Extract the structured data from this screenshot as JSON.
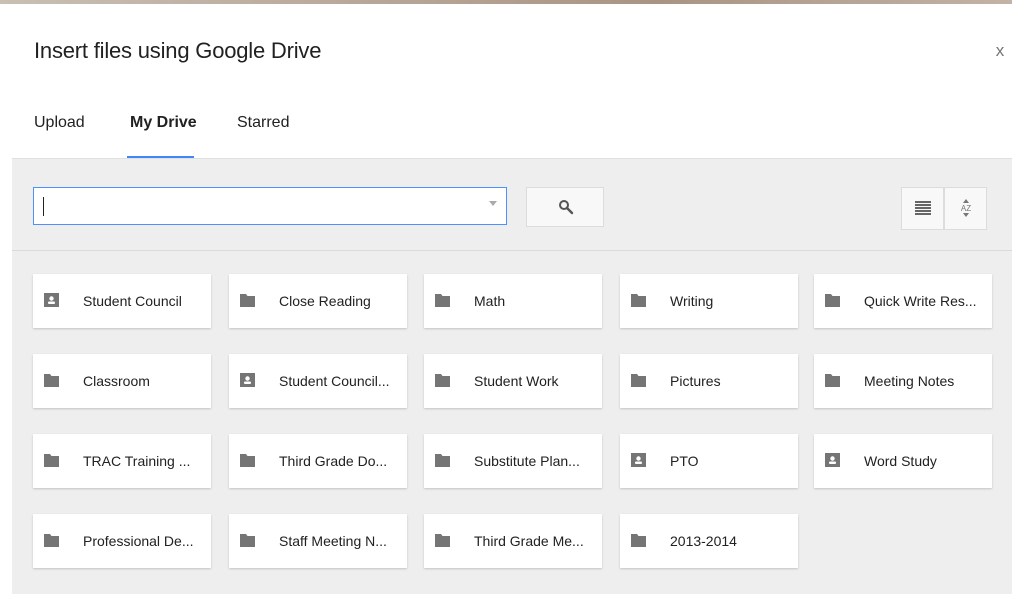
{
  "dialog": {
    "title": "Insert files using Google Drive",
    "close_label": "x"
  },
  "tabs": [
    {
      "label": "Upload",
      "active": false
    },
    {
      "label": "My Drive",
      "active": true
    },
    {
      "label": "Starred",
      "active": false
    }
  ],
  "search": {
    "value": "",
    "search_icon": "magnifier-icon"
  },
  "view_controls": {
    "list_view_icon": "list-view-icon",
    "sort_icon": "sort-az-icon",
    "sort_label": "AZ"
  },
  "folders": [
    {
      "label": "Student Council",
      "icon": "shared-folder-icon"
    },
    {
      "label": "Close Reading",
      "icon": "folder-icon"
    },
    {
      "label": "Math",
      "icon": "folder-icon"
    },
    {
      "label": "Writing",
      "icon": "folder-icon"
    },
    {
      "label": "Quick Write Res...",
      "icon": "folder-icon"
    },
    {
      "label": "Classroom",
      "icon": "folder-icon"
    },
    {
      "label": "Student Council...",
      "icon": "shared-folder-icon"
    },
    {
      "label": "Student Work",
      "icon": "folder-icon"
    },
    {
      "label": "Pictures",
      "icon": "folder-icon"
    },
    {
      "label": "Meeting Notes",
      "icon": "folder-icon"
    },
    {
      "label": "TRAC Training ...",
      "icon": "folder-icon"
    },
    {
      "label": "Third Grade Do...",
      "icon": "folder-icon"
    },
    {
      "label": "Substitute Plan...",
      "icon": "folder-icon"
    },
    {
      "label": "PTO",
      "icon": "shared-folder-icon"
    },
    {
      "label": "Word Study",
      "icon": "shared-folder-icon"
    },
    {
      "label": "Professional De...",
      "icon": "folder-icon"
    },
    {
      "label": "Staff Meeting N...",
      "icon": "folder-icon"
    },
    {
      "label": "Third Grade Me...",
      "icon": "folder-icon"
    },
    {
      "label": "2013-2014",
      "icon": "folder-icon"
    }
  ],
  "colors": {
    "accent": "#4285f4",
    "folder_icon": "#757575",
    "panel_bg": "#eeeeee"
  }
}
